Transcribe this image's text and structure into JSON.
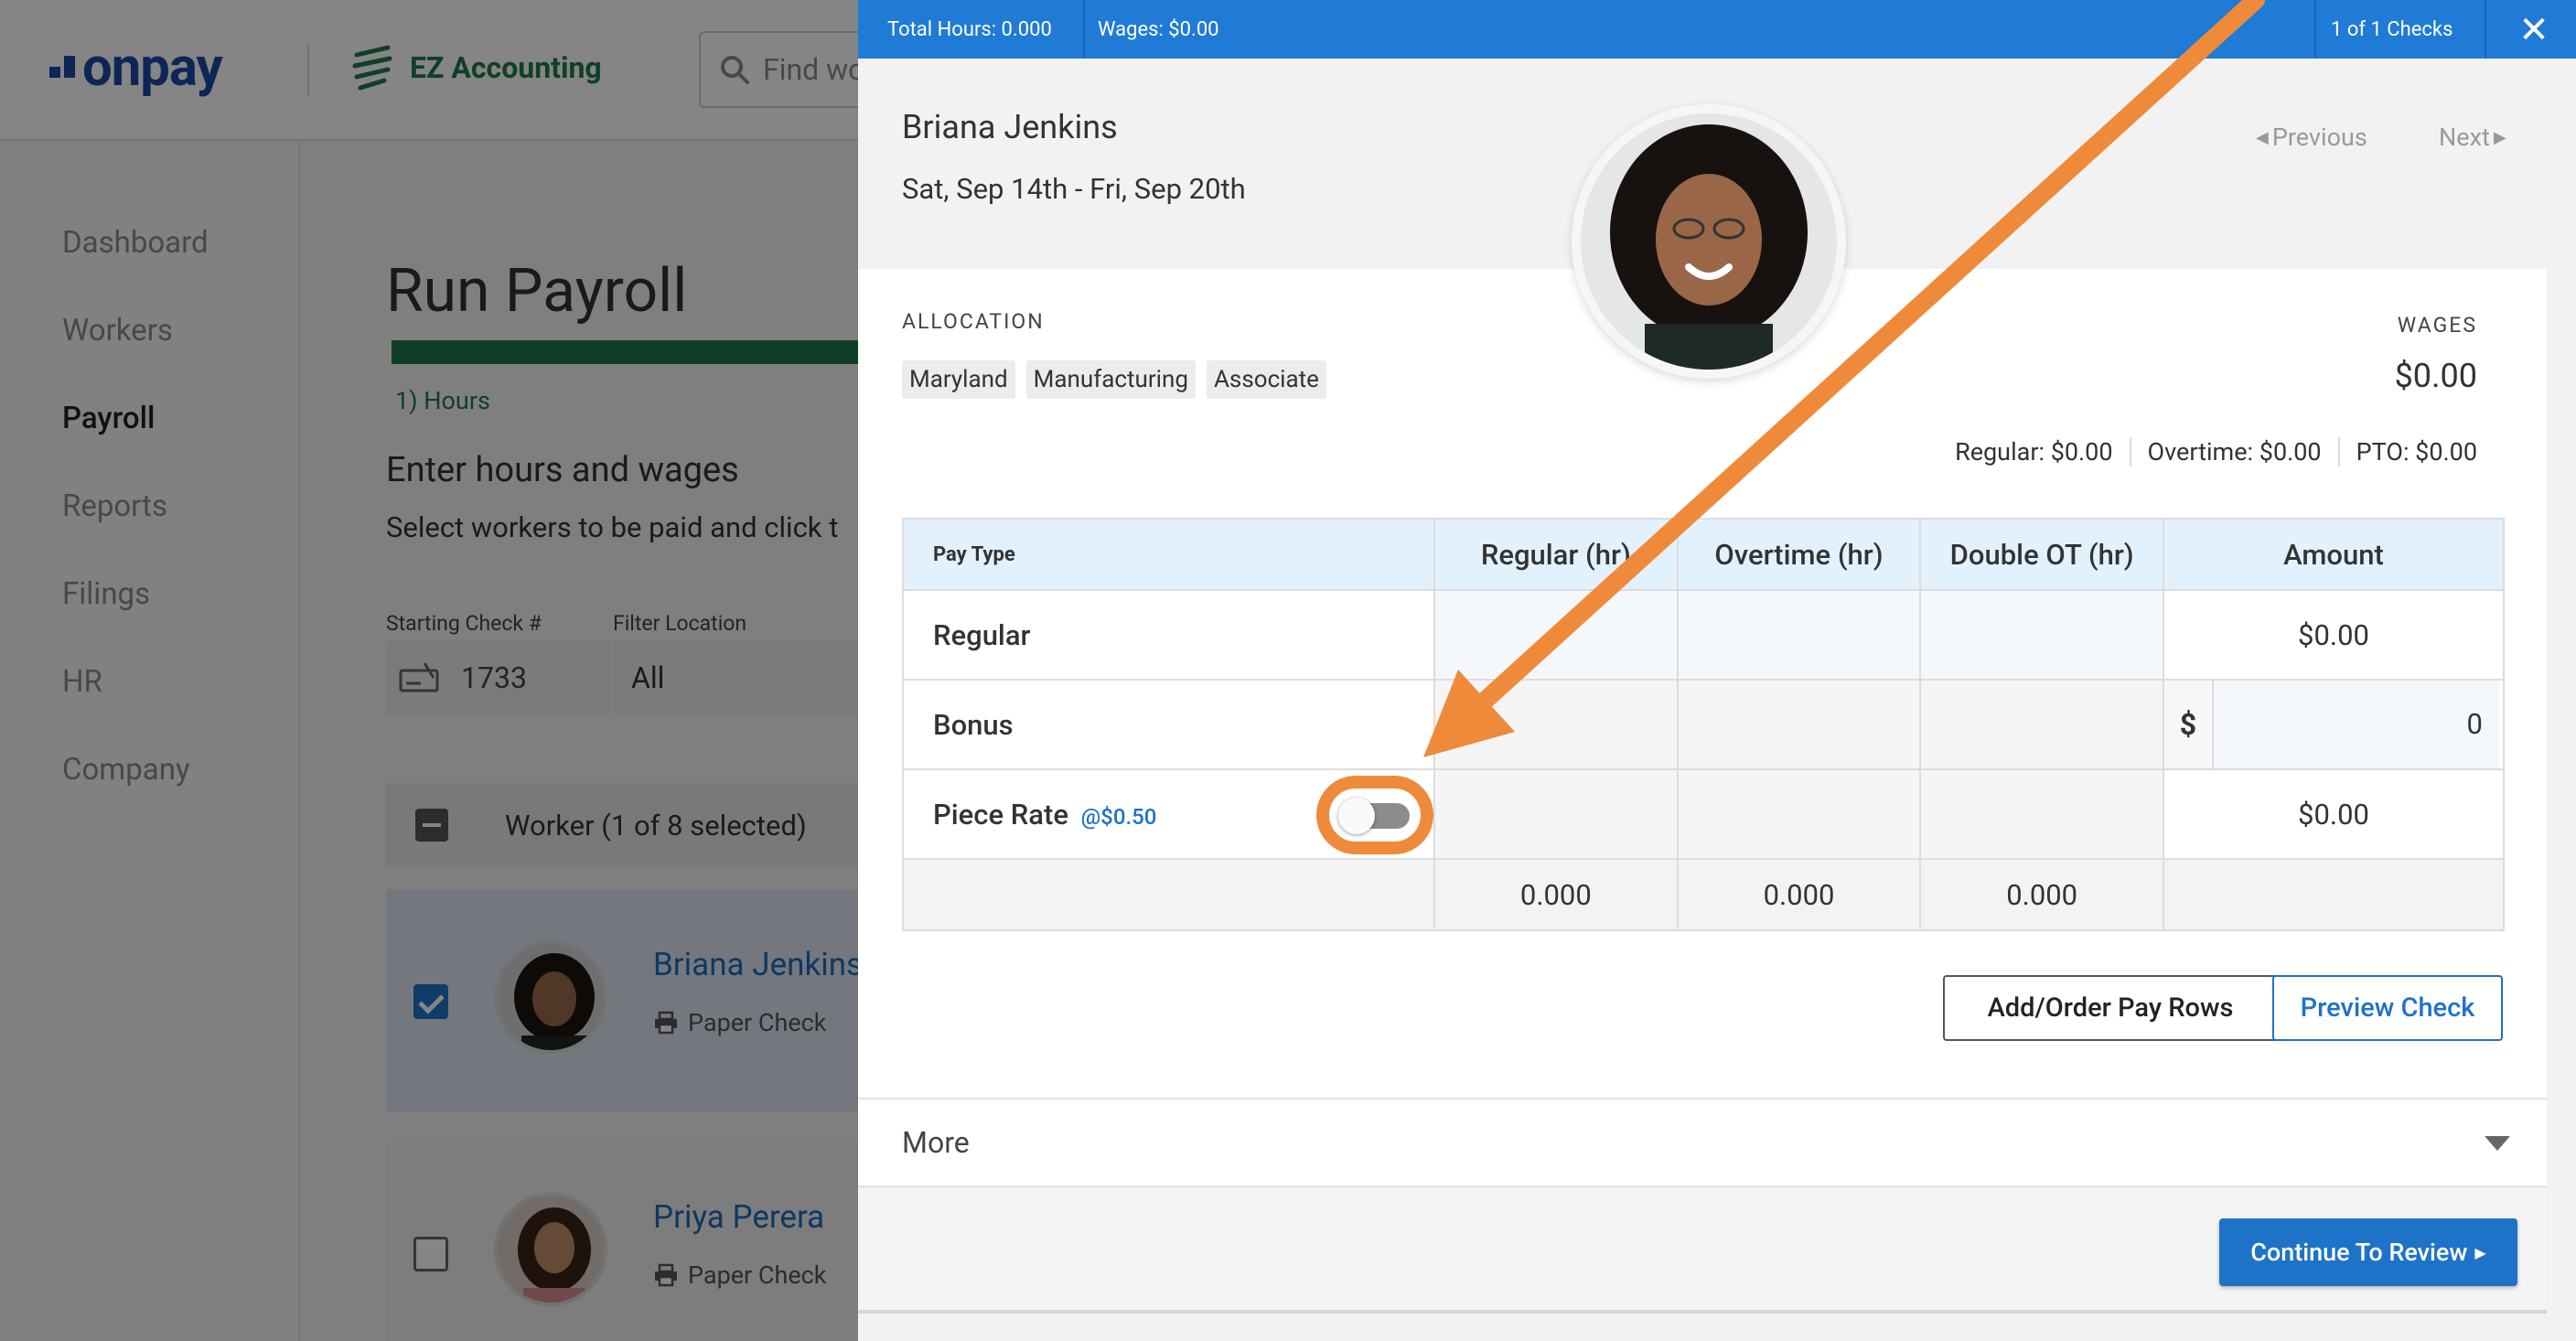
{
  "app": {
    "logo": "onpay",
    "partner": "EZ Accounting",
    "search_placeholder": "Find wo"
  },
  "sidebar": {
    "items": [
      {
        "label": "Dashboard"
      },
      {
        "label": "Workers"
      },
      {
        "label": "Payroll",
        "active": true
      },
      {
        "label": "Reports"
      },
      {
        "label": "Filings"
      },
      {
        "label": "HR"
      },
      {
        "label": "Company"
      }
    ]
  },
  "main": {
    "title": "Run Payroll",
    "step": "1) Hours",
    "section_title": "Enter hours and wages",
    "section_sub": "Select workers to be paid and click t",
    "starting_check_label": "Starting Check #",
    "starting_check_value": "1733",
    "filter_location_label": "Filter Location",
    "filter_location_value": "All",
    "worker_header": "Worker (1 of 8 selected)",
    "workers": [
      {
        "name": "Briana Jenkins",
        "pay_method": "Paper Check",
        "selected": true
      },
      {
        "name": "Priya Perera",
        "pay_method": "Paper Check",
        "selected": false
      }
    ]
  },
  "drawer": {
    "bar": {
      "total_hours": "Total Hours: 0.000",
      "wages": "Wages: $0.00",
      "check_count": "1 of 1 Checks"
    },
    "employee_name": "Briana Jenkins",
    "date_range": "Sat, Sep 14th - Fri, Sep 20th",
    "previous_label": "Previous",
    "next_label": "Next",
    "allocation_label": "ALLOCATION",
    "allocation_tags": [
      "Maryland",
      "Manufacturing",
      "Associate"
    ],
    "wages_label": "WAGES",
    "wages_value": "$0.00",
    "breakdown": {
      "regular": "Regular: $0.00",
      "overtime": "Overtime: $0.00",
      "pto": "PTO: $0.00"
    },
    "table": {
      "headers": [
        "Pay Type",
        "Regular (hr)",
        "Overtime (hr)",
        "Double OT (hr)",
        "Amount"
      ],
      "rows": {
        "regular": {
          "label": "Regular",
          "amount": "$0.00"
        },
        "bonus": {
          "label": "Bonus",
          "currency": "$",
          "amount": "0"
        },
        "piece_rate": {
          "label": "Piece Rate",
          "rate": "@$0.50",
          "amount": "$0.00",
          "toggle_on": false
        }
      },
      "totals": [
        "0.000",
        "0.000",
        "0.000"
      ]
    },
    "add_rows_label": "Add/Order Pay Rows",
    "preview_label": "Preview Check",
    "more_label": "More",
    "continue_label": "Continue To Review"
  },
  "colors": {
    "brand_blue": "#1f7bd6",
    "accent_green": "#1f7a4e",
    "annotation_orange": "#ef8a3a",
    "link_blue": "#1e73c8"
  }
}
